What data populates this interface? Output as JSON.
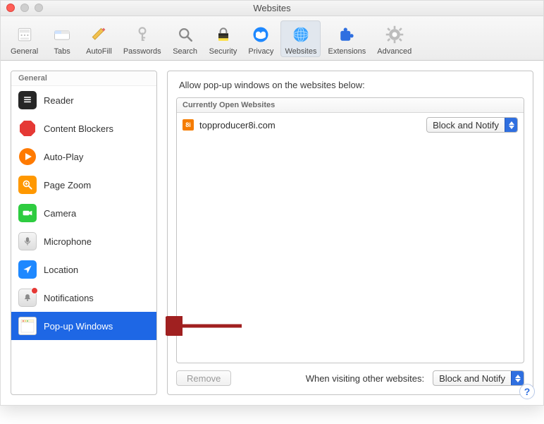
{
  "window": {
    "title": "Websites"
  },
  "toolbar": [
    {
      "id": "general",
      "label": "General"
    },
    {
      "id": "tabs",
      "label": "Tabs"
    },
    {
      "id": "autofill",
      "label": "AutoFill"
    },
    {
      "id": "passwords",
      "label": "Passwords"
    },
    {
      "id": "search",
      "label": "Search"
    },
    {
      "id": "security",
      "label": "Security"
    },
    {
      "id": "privacy",
      "label": "Privacy"
    },
    {
      "id": "websites",
      "label": "Websites"
    },
    {
      "id": "extensions",
      "label": "Extensions"
    },
    {
      "id": "advanced",
      "label": "Advanced"
    }
  ],
  "sidebar": {
    "section": "General",
    "items": [
      {
        "id": "reader",
        "label": "Reader"
      },
      {
        "id": "content-blockers",
        "label": "Content Blockers"
      },
      {
        "id": "auto-play",
        "label": "Auto-Play"
      },
      {
        "id": "page-zoom",
        "label": "Page Zoom"
      },
      {
        "id": "camera",
        "label": "Camera"
      },
      {
        "id": "microphone",
        "label": "Microphone"
      },
      {
        "id": "location",
        "label": "Location"
      },
      {
        "id": "notifications",
        "label": "Notifications"
      },
      {
        "id": "popup-windows",
        "label": "Pop-up Windows"
      }
    ],
    "selected": "popup-windows"
  },
  "panel": {
    "heading": "Allow pop-up windows on the websites below:",
    "list_header": "Currently Open Websites",
    "rows": [
      {
        "favicon": "8i",
        "site": "topproducer8i.com",
        "policy": "Block and Notify"
      }
    ],
    "remove_label": "Remove",
    "default_label": "When visiting other websites:",
    "default_policy": "Block and Notify"
  },
  "colors": {
    "close": "#ff5f57",
    "minimize": "#cfcfcf",
    "maximize": "#cfcfcf"
  }
}
